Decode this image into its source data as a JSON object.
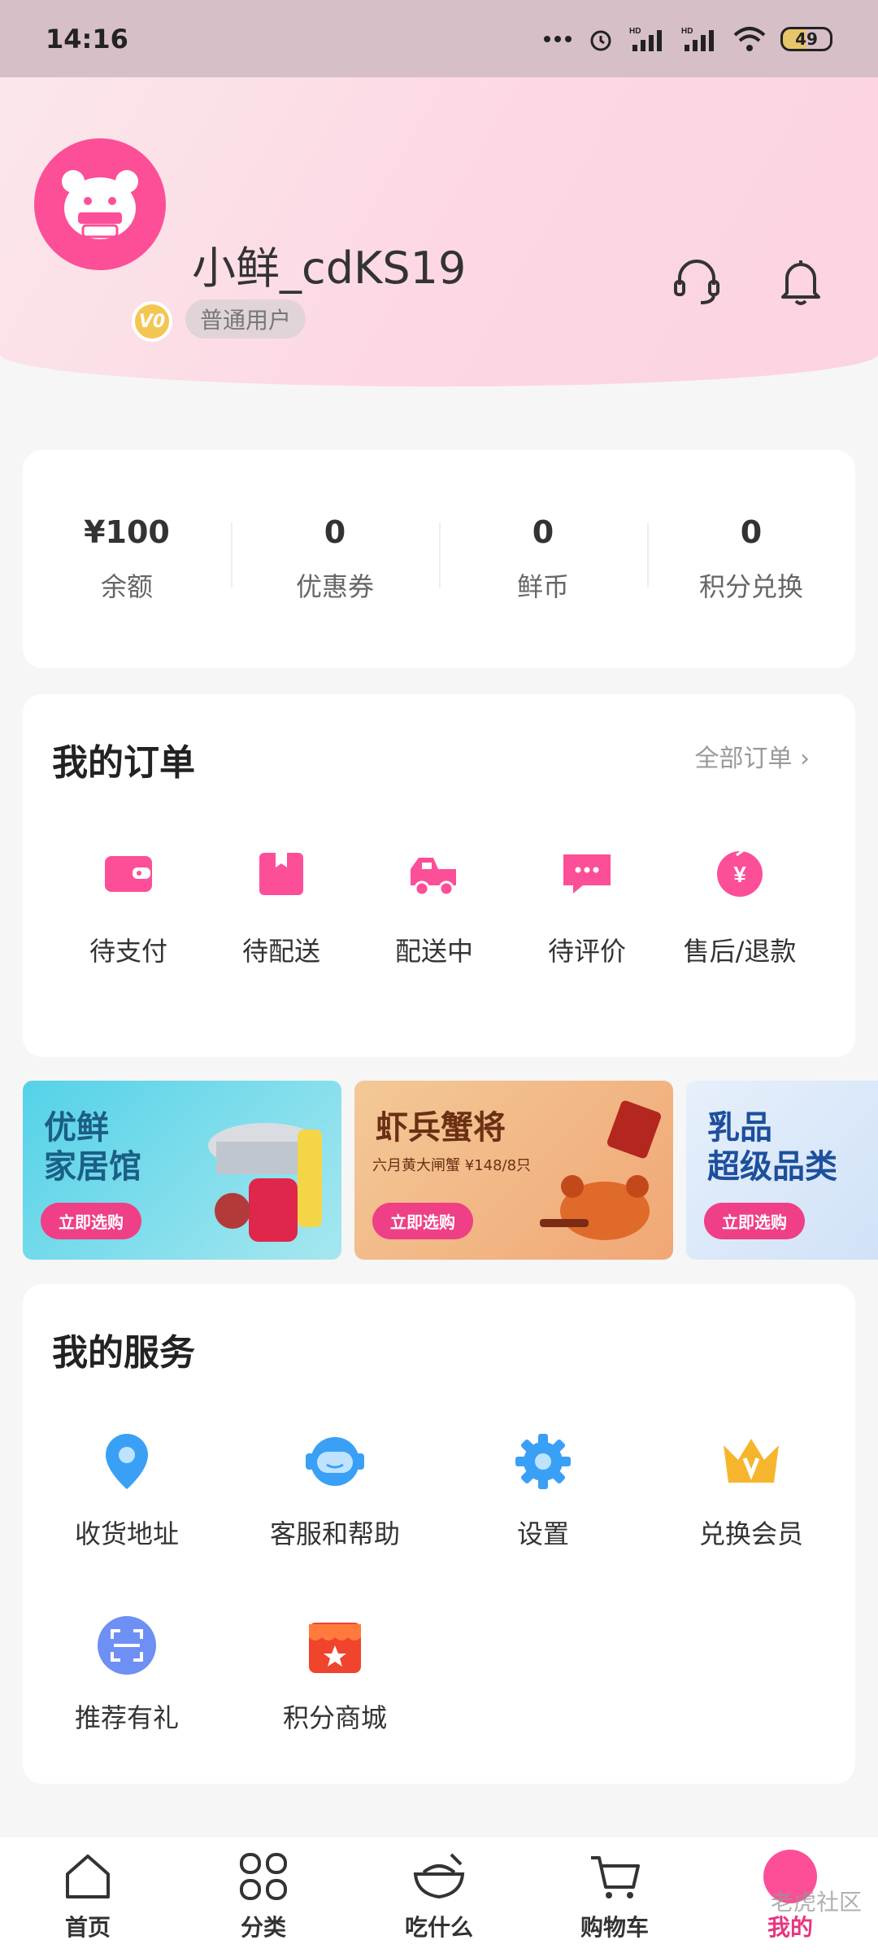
{
  "status_bar": {
    "time": "14:16",
    "battery": "49"
  },
  "user": {
    "name": "小鲜_cdKS19",
    "tag": "普通用户",
    "level_badge": "V0"
  },
  "stats": [
    {
      "value": "¥100",
      "label": "余额"
    },
    {
      "value": "0",
      "label": "优惠券"
    },
    {
      "value": "0",
      "label": "鲜币"
    },
    {
      "value": "0",
      "label": "积分兑换"
    }
  ],
  "orders": {
    "title": "我的订单",
    "all_link": "全部订单 ›",
    "items": [
      {
        "label": "待支付",
        "icon": "wallet-icon"
      },
      {
        "label": "待配送",
        "icon": "package-icon"
      },
      {
        "label": "配送中",
        "icon": "delivery-truck-icon"
      },
      {
        "label": "待评价",
        "icon": "comment-icon"
      },
      {
        "label": "售后/退款",
        "icon": "refund-icon"
      }
    ]
  },
  "banners": [
    {
      "title": "优鲜\n家居馆",
      "button": "立即选购"
    },
    {
      "title": "虾兵蟹将",
      "subtitle": "六月黄大闸蟹 ¥148/8只",
      "button": "立即选购"
    },
    {
      "title": "乳品\n超级品类",
      "button": "立即选购"
    }
  ],
  "services": {
    "title": "我的服务",
    "items": [
      {
        "label": "收货地址",
        "icon": "location-pin-icon"
      },
      {
        "label": "客服和帮助",
        "icon": "customer-service-icon"
      },
      {
        "label": "设置",
        "icon": "settings-gear-icon"
      },
      {
        "label": "兑换会员",
        "icon": "crown-icon"
      },
      {
        "label": "推荐有礼",
        "icon": "scan-icon"
      },
      {
        "label": "积分商城",
        "icon": "store-icon"
      }
    ]
  },
  "tabbar": [
    {
      "label": "首页",
      "icon": "home-icon"
    },
    {
      "label": "分类",
      "icon": "category-grid-icon"
    },
    {
      "label": "吃什么",
      "icon": "food-bowl-icon"
    },
    {
      "label": "购物车",
      "icon": "cart-icon"
    },
    {
      "label": "我的",
      "icon": "profile-icon",
      "active": true
    }
  ],
  "watermark": "老虎社区",
  "colors": {
    "brand_pink": "#fc4f97",
    "active_tab": "#e8357f",
    "service_blue": "#3aa0f5"
  }
}
